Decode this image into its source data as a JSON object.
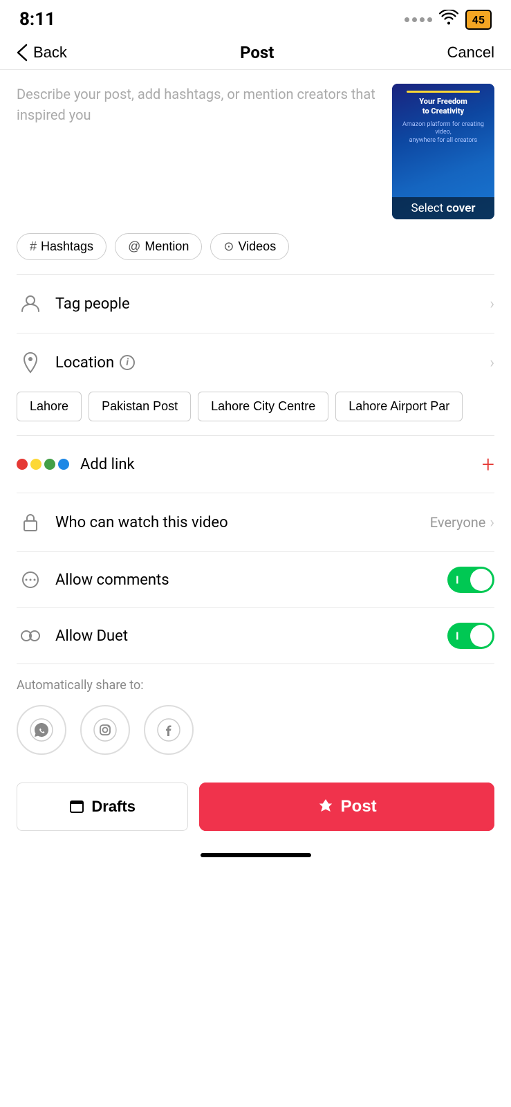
{
  "status": {
    "time": "8:11",
    "battery": "45"
  },
  "header": {
    "back_label": "Back",
    "title": "Post",
    "cancel_label": "Cancel"
  },
  "description": {
    "placeholder": "Describe your post, add hashtags, or mention creators that inspired you",
    "cover_label": "Select cover"
  },
  "tags": [
    {
      "id": "hashtags",
      "icon": "#",
      "label": "Hashtags"
    },
    {
      "id": "mention",
      "icon": "@",
      "label": "Mention"
    },
    {
      "id": "videos",
      "icon": "▶",
      "label": "Videos"
    }
  ],
  "tag_people": {
    "label": "Tag people"
  },
  "location": {
    "label": "Location",
    "chips": [
      "Lahore",
      "Pakistan Post",
      "Lahore City Centre",
      "Lahore Airport Par"
    ]
  },
  "add_link": {
    "label": "Add link"
  },
  "who_can_watch": {
    "label": "Who can watch this video",
    "value": "Everyone"
  },
  "allow_comments": {
    "label": "Allow comments",
    "enabled": true
  },
  "allow_duet": {
    "label": "Allow Duet",
    "enabled": true
  },
  "auto_share": {
    "label": "Automatically share to:"
  },
  "bottom": {
    "drafts_label": "Drafts",
    "post_label": "Post"
  }
}
